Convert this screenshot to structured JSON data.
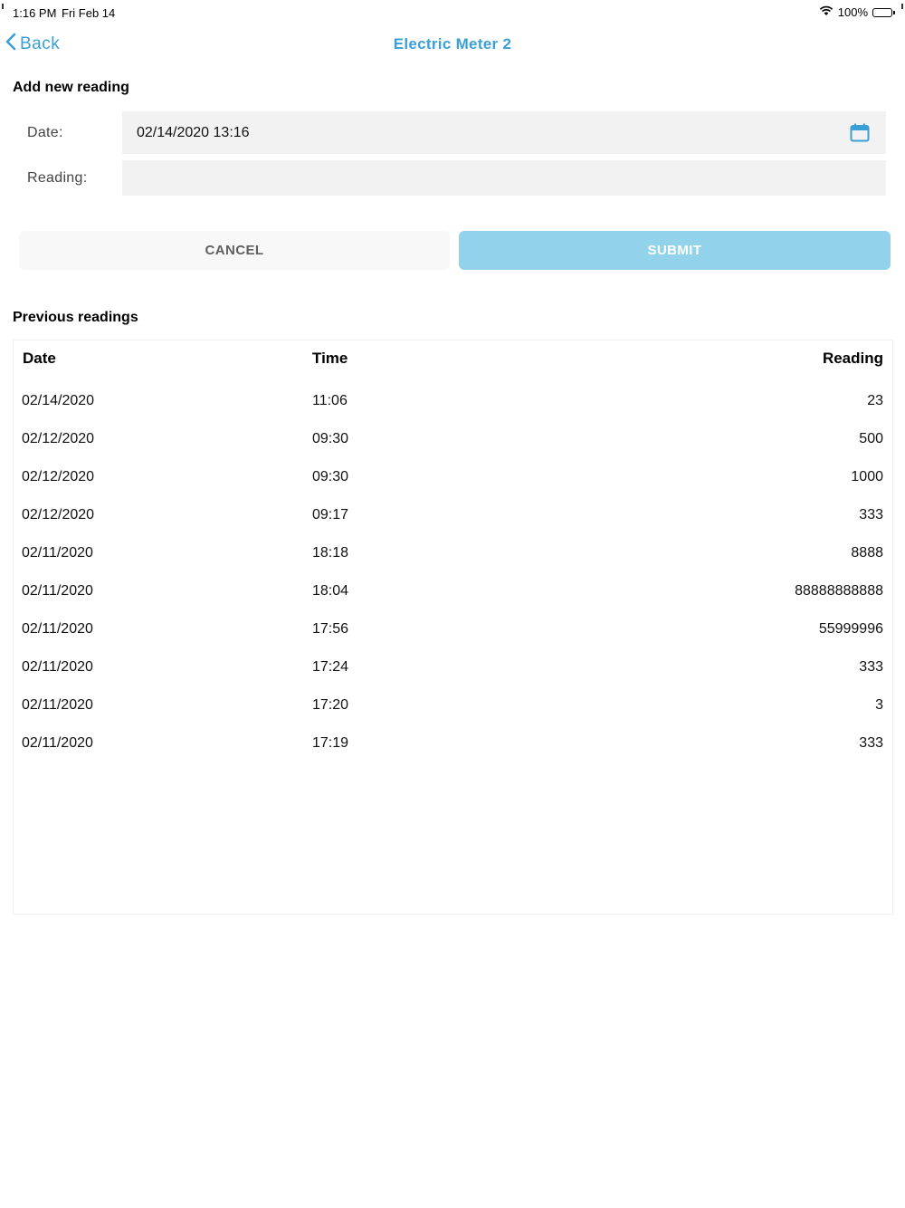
{
  "status_bar": {
    "time": "1:16 PM",
    "date": "Fri Feb 14",
    "battery_percent": "100%",
    "icons": [
      "wifi-icon",
      "battery-icon"
    ]
  },
  "nav": {
    "back_label": "Back",
    "title": "Electric Meter 2",
    "accent_color": "#3a9fd6"
  },
  "form": {
    "section_title": "Add new reading",
    "date_label": "Date:",
    "date_value": "02/14/2020 13:16",
    "reading_label": "Reading:",
    "reading_value": "",
    "calendar_icon": "calendar-icon"
  },
  "actions": {
    "cancel_label": "CANCEL",
    "submit_label": "SUBMIT",
    "submit_color": "#92d2ea"
  },
  "readings": {
    "section_title": "Previous readings",
    "columns": [
      "Date",
      "Time",
      "Reading"
    ],
    "rows": [
      {
        "date": "02/14/2020",
        "time": "11:06",
        "reading": "23"
      },
      {
        "date": "02/12/2020",
        "time": "09:30",
        "reading": "500"
      },
      {
        "date": "02/12/2020",
        "time": "09:30",
        "reading": "1000"
      },
      {
        "date": "02/12/2020",
        "time": "09:17",
        "reading": "333"
      },
      {
        "date": "02/11/2020",
        "time": "18:18",
        "reading": "8888"
      },
      {
        "date": "02/11/2020",
        "time": "18:04",
        "reading": "88888888888"
      },
      {
        "date": "02/11/2020",
        "time": "17:56",
        "reading": "55999996"
      },
      {
        "date": "02/11/2020",
        "time": "17:24",
        "reading": "333"
      },
      {
        "date": "02/11/2020",
        "time": "17:20",
        "reading": "3"
      },
      {
        "date": "02/11/2020",
        "time": "17:19",
        "reading": "333"
      }
    ]
  }
}
